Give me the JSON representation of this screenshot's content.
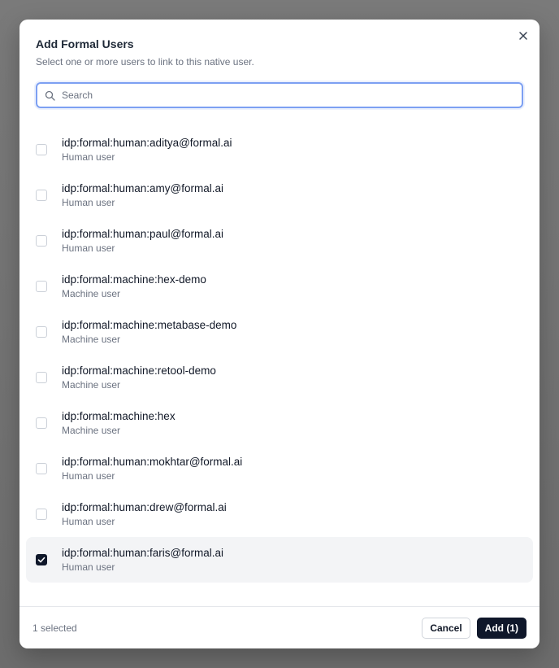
{
  "modal": {
    "title": "Add Formal Users",
    "subtitle": "Select one or more users to link to this native user.",
    "search_placeholder": "Search"
  },
  "users": [
    {
      "name": "idp:formal:human:aditya@formal.ai",
      "type": "Human user",
      "checked": false
    },
    {
      "name": "idp:formal:human:amy@formal.ai",
      "type": "Human user",
      "checked": false
    },
    {
      "name": "idp:formal:human:paul@formal.ai",
      "type": "Human user",
      "checked": false
    },
    {
      "name": "idp:formal:machine:hex-demo",
      "type": "Machine user",
      "checked": false
    },
    {
      "name": "idp:formal:machine:metabase-demo",
      "type": "Machine user",
      "checked": false
    },
    {
      "name": "idp:formal:machine:retool-demo",
      "type": "Machine user",
      "checked": false
    },
    {
      "name": "idp:formal:machine:hex",
      "type": "Machine user",
      "checked": false
    },
    {
      "name": "idp:formal:human:mokhtar@formal.ai",
      "type": "Human user",
      "checked": false
    },
    {
      "name": "idp:formal:human:drew@formal.ai",
      "type": "Human user",
      "checked": false
    },
    {
      "name": "idp:formal:human:faris@formal.ai",
      "type": "Human user",
      "checked": true
    }
  ],
  "footer": {
    "selected_count": "1 selected",
    "cancel_label": "Cancel",
    "add_label": "Add (1)"
  },
  "colors": {
    "accent": "#0f172a",
    "focus_ring": "#7da0f2",
    "selected_row_bg": "#f3f4f6"
  },
  "icons": {
    "close": "close-icon",
    "search": "search-icon",
    "check": "check-icon"
  }
}
